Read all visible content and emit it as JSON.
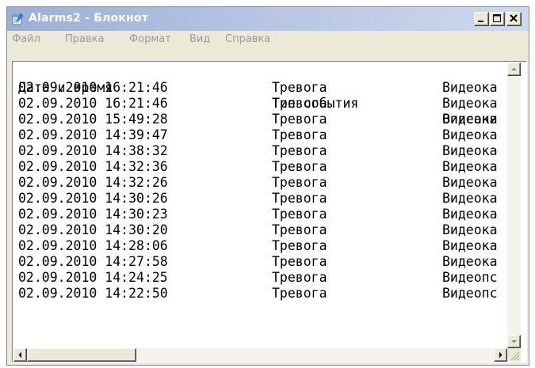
{
  "window": {
    "title": "Alarms2 - Блокнот",
    "controls": {
      "minimize": "minimize",
      "maximize": "maximize",
      "close": "close"
    }
  },
  "menu": {
    "items": [
      "Файл",
      "Правка",
      "Формат",
      "Вид",
      "Справка"
    ]
  },
  "document": {
    "header": {
      "date": "Дата и время",
      "type": "Тип события",
      "desc": "Описани"
    },
    "rows": [
      {
        "date": "02.09.2010 16:21:46",
        "type": "Тревога",
        "desc": "Видеока"
      },
      {
        "date": "02.09.2010 16:21:46",
        "type": "Тревога",
        "desc": "Видеока"
      },
      {
        "date": "02.09.2010 15:49:28",
        "type": "Тревога",
        "desc": "Видеока"
      },
      {
        "date": "02.09.2010 14:39:47",
        "type": "Тревога",
        "desc": "Видеока"
      },
      {
        "date": "02.09.2010 14:38:32",
        "type": "Тревога",
        "desc": "Видеока"
      },
      {
        "date": "02.09.2010 14:32:36",
        "type": "Тревога",
        "desc": "Видеока"
      },
      {
        "date": "02.09.2010 14:32:26",
        "type": "Тревога",
        "desc": "Видеока"
      },
      {
        "date": "02.09.2010 14:30:26",
        "type": "Тревога",
        "desc": "Видеока"
      },
      {
        "date": "02.09.2010 14:30:23",
        "type": "Тревога",
        "desc": "Видеока"
      },
      {
        "date": "02.09.2010 14:30:20",
        "type": "Тревога",
        "desc": "Видеока"
      },
      {
        "date": "02.09.2010 14:28:06",
        "type": "Тревога",
        "desc": "Видеока"
      },
      {
        "date": "02.09.2010 14:27:58",
        "type": "Тревога",
        "desc": "Видеока"
      },
      {
        "date": "02.09.2010 14:24:25",
        "type": "Тревога",
        "desc": "Видеопс"
      },
      {
        "date": "02.09.2010 14:22:50",
        "type": "Тревога",
        "desc": "Видеопс"
      }
    ]
  },
  "icons": {
    "app": "notepad-icon",
    "scroll_up": "arrow-up-icon",
    "scroll_down": "arrow-down-icon",
    "scroll_left": "arrow-left-icon",
    "scroll_right": "arrow-right-icon",
    "resize": "resize-grip-icon"
  },
  "colors": {
    "titlebar_start": "#9ab0d6",
    "titlebar_end": "#cfd9ee",
    "menu_text": "#9a9a9a",
    "chrome": "#ece9d8"
  }
}
